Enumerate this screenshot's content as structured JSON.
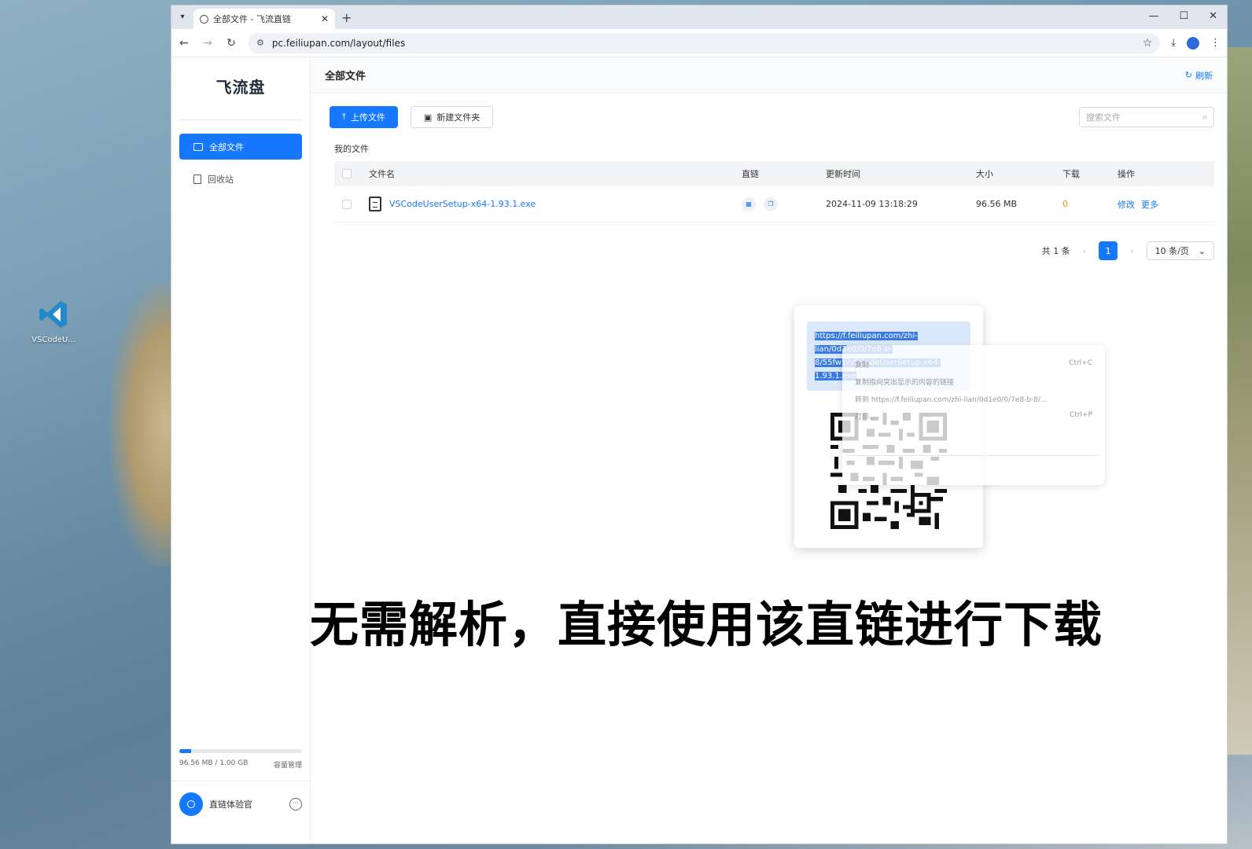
{
  "desktop": {
    "icon_label": "VSCodeU..."
  },
  "browser": {
    "tab_title": "全部文件 - 飞流直链",
    "url": "pc.feiliupan.com/layout/files"
  },
  "sidebar": {
    "logo": "飞流盘",
    "items": [
      {
        "label": "全部文件",
        "active": true
      },
      {
        "label": "回收站",
        "active": false
      }
    ],
    "storage": {
      "used_text": "96.56 MB / 1.00 GB",
      "manage_label": "容量管理",
      "used_fraction": 0.094
    },
    "user_name": "直链体验官"
  },
  "header": {
    "title": "全部文件",
    "refresh_label": "刷新"
  },
  "toolbar": {
    "upload_label": "上传文件",
    "new_folder_label": "新建文件夹",
    "search_placeholder": "搜索文件"
  },
  "breadcrumb": "我的文件",
  "table": {
    "headers": [
      "文件名",
      "直链",
      "更新时间",
      "大小",
      "下载",
      "操作"
    ],
    "rows": [
      {
        "name": "VSCodeUserSetup-x64-1.93.1.exe",
        "updated": "2024-11-09 13:18:29",
        "size": "96.56 MB",
        "downloads": "0",
        "edit": "修改",
        "more": "更多"
      }
    ]
  },
  "pager": {
    "total": "共 1 条",
    "current": "1",
    "page_size": "10 条/页"
  },
  "popover": {
    "url_lines": [
      "https://f.feiliupan.com/zhi-",
      "lian/0d1e0/0/7e8-b-",
      "8/55fw1/VSCodeUserSetup-x64-",
      "1.93.1.exe"
    ]
  },
  "context_menu": {
    "items": [
      {
        "label": "复制",
        "shortcut": "Ctrl+C"
      },
      {
        "label": "复制指向突出显示的内容的链接",
        "shortcut": ""
      },
      {
        "label": "转到 https://f.feiliupan.com/zhi-lian/0d1e0/0/7e8-b-8/...",
        "shortcut": ""
      },
      {
        "label": "打印...",
        "shortcut": "Ctrl+P"
      }
    ]
  },
  "caption": "无需解析，直接使用该直链进行下载",
  "colors": {
    "primary": "#1677ff",
    "download_count": "#fa8c16"
  }
}
